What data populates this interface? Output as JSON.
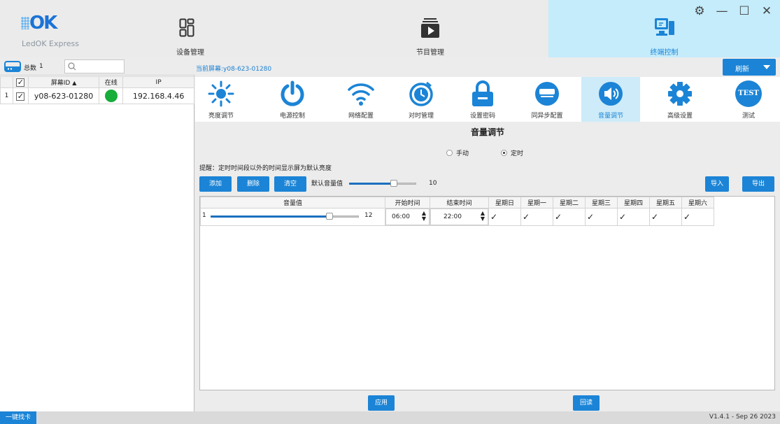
{
  "app": {
    "logo_text": "OK",
    "name": "LedOK Express"
  },
  "nav": [
    {
      "label": "设备管理",
      "icon": "device-management-icon"
    },
    {
      "label": "节目管理",
      "icon": "program-management-icon"
    },
    {
      "label": "终端控制",
      "icon": "terminal-control-icon",
      "active": true
    }
  ],
  "window_controls": {
    "settings": "⚙",
    "minimize": "—",
    "maximize": "☐",
    "close": "✕"
  },
  "left_panel": {
    "total_label": "总数",
    "total_count": "1",
    "columns": [
      "屏幕ID",
      "在线",
      "IP"
    ],
    "rows": [
      {
        "index": "1",
        "checked": "✓",
        "id": "y08-623-01280",
        "online": true,
        "ip": "192.168.4.46"
      }
    ]
  },
  "current_screen": {
    "label": "当前屏幕:",
    "value": "y08-623-01280"
  },
  "refresh_label": "刷新",
  "functions": [
    {
      "label": "亮度调节",
      "icon": "brightness-icon"
    },
    {
      "label": "电源控制",
      "icon": "power-icon"
    },
    {
      "label": "网络配置",
      "icon": "wifi-icon"
    },
    {
      "label": "对时管理",
      "icon": "time-sync-icon"
    },
    {
      "label": "设置密码",
      "icon": "password-lock-icon"
    },
    {
      "label": "同异步配置",
      "icon": "sync-async-icon"
    },
    {
      "label": "音量调节",
      "icon": "volume-icon",
      "active": true
    },
    {
      "label": "高级设置",
      "icon": "advanced-settings-icon"
    },
    {
      "label": "测试",
      "icon": "test-icon",
      "icon_text": "TEST"
    }
  ],
  "volume": {
    "title": "音量调节",
    "mode_manual": "手动",
    "mode_timed": "定时",
    "selected_mode": "定时",
    "hint": "提醒：定时时间段以外的时间显示屏为默认亮度",
    "buttons": {
      "add": "添加",
      "delete": "删除",
      "clear": "清空",
      "import": "导入",
      "export": "导出"
    },
    "default_label": "默认音量值",
    "default_value": "10",
    "default_fraction": 0.667,
    "columns": [
      "音量值",
      "开始时间",
      "结束时间",
      "星期日",
      "星期一",
      "星期二",
      "星期三",
      "星期四",
      "星期五",
      "星期六"
    ],
    "rows": [
      {
        "index": "1",
        "value": "12",
        "fraction": 0.8,
        "start": "06:00",
        "end": "22:00",
        "days": [
          "✓",
          "✓",
          "✓",
          "✓",
          "✓",
          "✓",
          "✓"
        ]
      }
    ],
    "apply": "应用",
    "readback": "回读"
  },
  "footer": {
    "find_card": "一键找卡",
    "version": "V1.4.1 - Sep 26 2023"
  },
  "colors": {
    "accent": "#1b84d6",
    "online": "#16ad3a",
    "active_tab": "#c4ecfb"
  }
}
